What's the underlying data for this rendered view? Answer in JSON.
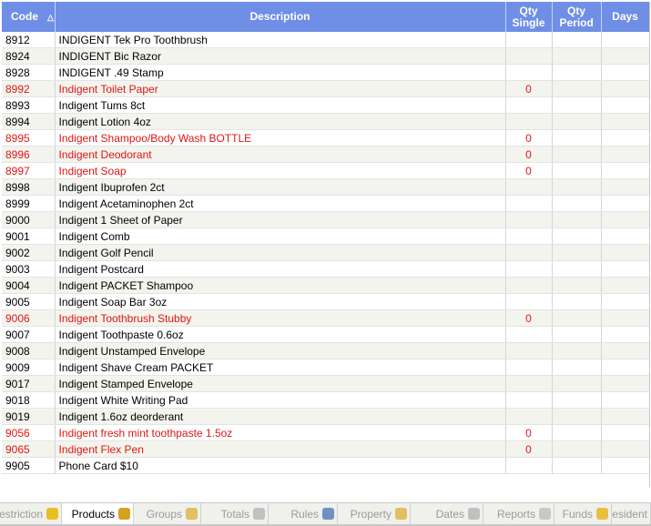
{
  "columns": {
    "code": "Code",
    "description": "Description",
    "qty_single": "Qty Single",
    "qty_period": "Qty Period",
    "days": "Days",
    "sort_indicator": "△"
  },
  "rows": [
    {
      "code": "8912",
      "description": "INDIGENT Tek Pro Toothbrush",
      "qty_single": "",
      "qty_period": "",
      "days": "",
      "red": false
    },
    {
      "code": "8924",
      "description": "INDIGENT Bic Razor",
      "qty_single": "",
      "qty_period": "",
      "days": "",
      "red": false
    },
    {
      "code": "8928",
      "description": "INDIGENT .49 Stamp",
      "qty_single": "",
      "qty_period": "",
      "days": "",
      "red": false
    },
    {
      "code": "8992",
      "description": "Indigent Toilet Paper",
      "qty_single": "0",
      "qty_period": "",
      "days": "",
      "red": true
    },
    {
      "code": "8993",
      "description": "Indigent Tums 8ct",
      "qty_single": "",
      "qty_period": "",
      "days": "",
      "red": false
    },
    {
      "code": "8994",
      "description": "Indigent Lotion 4oz",
      "qty_single": "",
      "qty_period": "",
      "days": "",
      "red": false
    },
    {
      "code": "8995",
      "description": "Indigent Shampoo/Body Wash BOTTLE",
      "qty_single": "0",
      "qty_period": "",
      "days": "",
      "red": true
    },
    {
      "code": "8996",
      "description": "Indigent Deodorant",
      "qty_single": "0",
      "qty_period": "",
      "days": "",
      "red": true
    },
    {
      "code": "8997",
      "description": "Indigent Soap",
      "qty_single": "0",
      "qty_period": "",
      "days": "",
      "red": true
    },
    {
      "code": "8998",
      "description": "Indigent Ibuprofen 2ct",
      "qty_single": "",
      "qty_period": "",
      "days": "",
      "red": false
    },
    {
      "code": "8999",
      "description": "Indigent Acetaminophen 2ct",
      "qty_single": "",
      "qty_period": "",
      "days": "",
      "red": false
    },
    {
      "code": "9000",
      "description": "Indigent 1 Sheet of Paper",
      "qty_single": "",
      "qty_period": "",
      "days": "",
      "red": false
    },
    {
      "code": "9001",
      "description": "Indigent Comb",
      "qty_single": "",
      "qty_period": "",
      "days": "",
      "red": false
    },
    {
      "code": "9002",
      "description": "Indigent Golf Pencil",
      "qty_single": "",
      "qty_period": "",
      "days": "",
      "red": false
    },
    {
      "code": "9003",
      "description": "Indigent Postcard",
      "qty_single": "",
      "qty_period": "",
      "days": "",
      "red": false
    },
    {
      "code": "9004",
      "description": "Indigent PACKET Shampoo",
      "qty_single": "",
      "qty_period": "",
      "days": "",
      "red": false
    },
    {
      "code": "9005",
      "description": "Indigent Soap Bar 3oz",
      "qty_single": "",
      "qty_period": "",
      "days": "",
      "red": false
    },
    {
      "code": "9006",
      "description": "Indigent Toothbrush Stubby",
      "qty_single": "0",
      "qty_period": "",
      "days": "",
      "red": true
    },
    {
      "code": "9007",
      "description": "Indigent Toothpaste 0.6oz",
      "qty_single": "",
      "qty_period": "",
      "days": "",
      "red": false
    },
    {
      "code": "9008",
      "description": "Indigent Unstamped Envelope",
      "qty_single": "",
      "qty_period": "",
      "days": "",
      "red": false
    },
    {
      "code": "9009",
      "description": "Indigent Shave Cream PACKET",
      "qty_single": "",
      "qty_period": "",
      "days": "",
      "red": false
    },
    {
      "code": "9017",
      "description": "Indigent Stamped Envelope",
      "qty_single": "",
      "qty_period": "",
      "days": "",
      "red": false
    },
    {
      "code": "9018",
      "description": "Indigent White Writing Pad",
      "qty_single": "",
      "qty_period": "",
      "days": "",
      "red": false
    },
    {
      "code": "9019",
      "description": "Indigent 1.6oz deorderant",
      "qty_single": "",
      "qty_period": "",
      "days": "",
      "red": false
    },
    {
      "code": "9056",
      "description": "Indigent fresh mint toothpaste 1.5oz",
      "qty_single": "0",
      "qty_period": "",
      "days": "",
      "red": true
    },
    {
      "code": "9065",
      "description": "Indigent Flex Pen",
      "qty_single": "0",
      "qty_period": "",
      "days": "",
      "red": true
    },
    {
      "code": "9905",
      "description": "Phone Card $10",
      "qty_single": "",
      "qty_period": "",
      "days": "",
      "red": false
    }
  ],
  "tabs": [
    {
      "label": "Restriction",
      "icon": "warning-icon",
      "icon_color": "#e8c020",
      "active": false
    },
    {
      "label": "Products",
      "icon": "box-icon",
      "icon_color": "#d8a020",
      "active": true
    },
    {
      "label": "Groups",
      "icon": "group-icon",
      "icon_color": "#e0c060",
      "active": false
    },
    {
      "label": "Totals",
      "icon": "calculator-icon",
      "icon_color": "#c0c0c0",
      "active": false
    },
    {
      "label": "Rules",
      "icon": "rules-icon",
      "icon_color": "#7090c0",
      "active": false
    },
    {
      "label": "Property",
      "icon": "box-icon",
      "icon_color": "#e0c060",
      "active": false
    },
    {
      "label": "Dates",
      "icon": "calendar-icon",
      "icon_color": "#c0c0c0",
      "active": false
    },
    {
      "label": "Reports",
      "icon": "report-icon",
      "icon_color": "#c8c8c8",
      "active": false
    },
    {
      "label": "Funds",
      "icon": "coin-icon",
      "icon_color": "#e8c040",
      "active": false
    },
    {
      "label": "Resident",
      "icon": "",
      "icon_color": "",
      "active": false
    }
  ],
  "colors": {
    "header_bg": "#6f8ee6",
    "row_red": "#e01515",
    "row_alt": "#f4f4ee"
  }
}
